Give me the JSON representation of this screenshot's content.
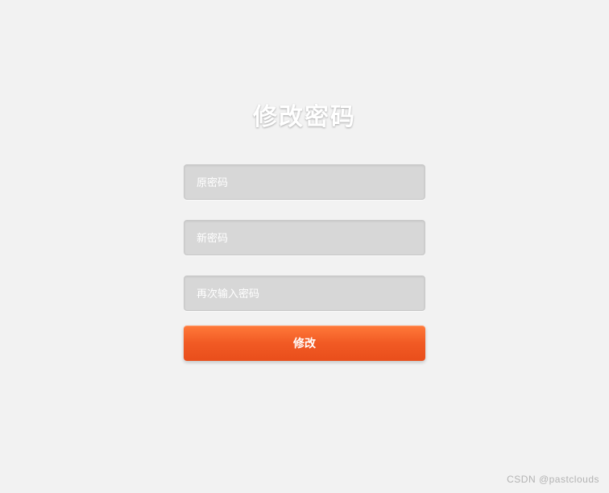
{
  "title": "修改密码",
  "form": {
    "old_password": {
      "placeholder": "原密码",
      "value": ""
    },
    "new_password": {
      "placeholder": "新密码",
      "value": ""
    },
    "confirm_password": {
      "placeholder": "再次输入密码",
      "value": ""
    },
    "submit_label": "修改"
  },
  "watermark": "CSDN @pastclouds",
  "colors": {
    "background": "#f2f2f2",
    "input_bg": "#d7d7d7",
    "button_gradient_top": "#ff7a3a",
    "button_gradient_bottom": "#e94e1b"
  }
}
